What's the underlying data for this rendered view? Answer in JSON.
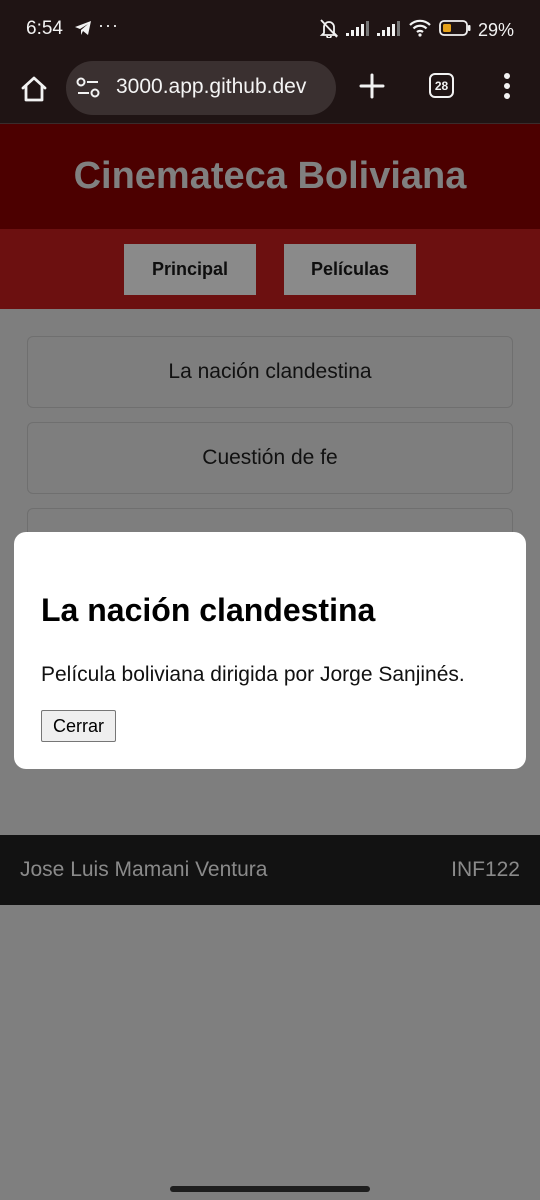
{
  "status_bar": {
    "time": "6:54",
    "battery_pct": "29%",
    "icons": [
      "telegram-icon",
      "more-icon",
      "mute-icon",
      "signal-icon",
      "signal-icon",
      "wifi-icon",
      "battery-icon"
    ]
  },
  "browser": {
    "url": "3000.app.github.dev",
    "tab_count": "28"
  },
  "site": {
    "title": "Cinemateca Boliviana",
    "nav": [
      {
        "label": "Principal"
      },
      {
        "label": "Películas"
      }
    ],
    "movies": [
      {
        "title": "La nación clandestina"
      },
      {
        "title": "Cuestión de fe"
      }
    ],
    "footer": {
      "name": "Jose Luis Mamani Ventura",
      "course": "INF122"
    }
  },
  "modal": {
    "title": "La nación clandestina",
    "description": "Película boliviana dirigida por Jorge Sanjinés.",
    "close_label": "Cerrar"
  },
  "colors": {
    "header_bg": "#4c0000",
    "nav_bg": "#6c1010",
    "footer_bg": "#121212",
    "overlay_bg": "#7f7f7f"
  }
}
